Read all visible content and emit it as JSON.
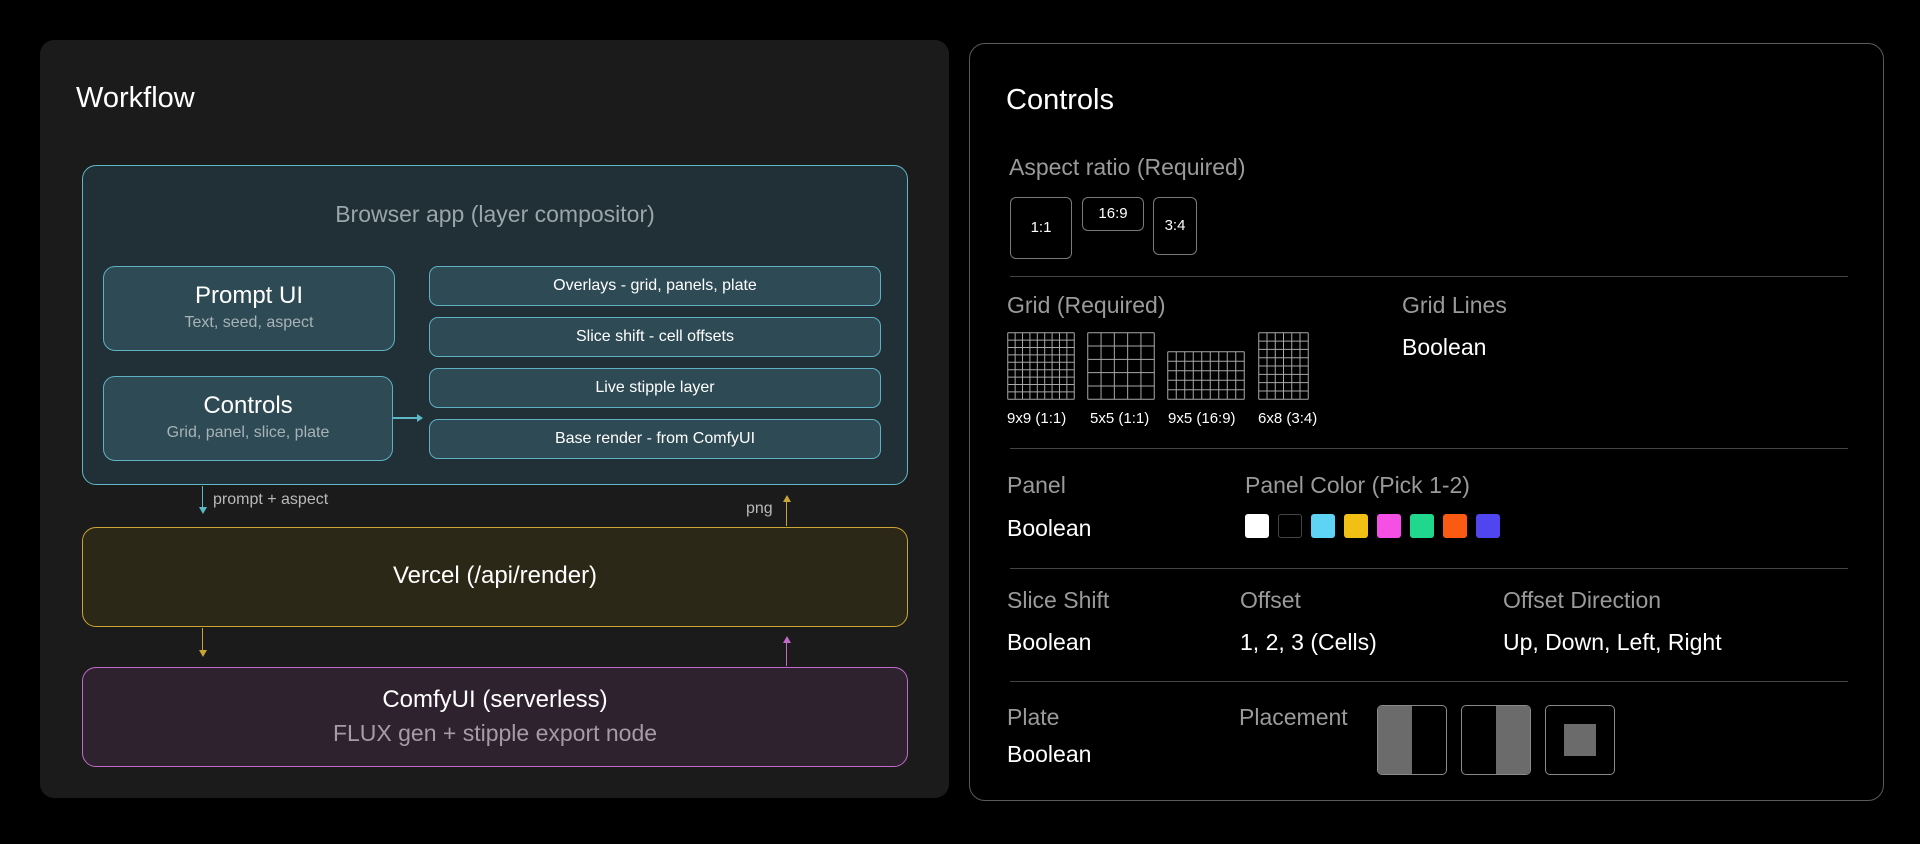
{
  "workflow": {
    "title": "Workflow",
    "browser_app": {
      "title": "Browser app (layer compositor)",
      "prompt_ui": {
        "title": "Prompt UI",
        "subtitle": "Text, seed, aspect"
      },
      "controls": {
        "title": "Controls",
        "subtitle": "Grid, panel, slice, plate"
      },
      "layers": [
        "Overlays - grid, panels, plate",
        "Slice shift - cell offsets",
        "Live stipple layer",
        "Base render - from ComfyUI"
      ]
    },
    "arrow_labels": {
      "down": "prompt + aspect",
      "up": "png"
    },
    "vercel": {
      "title": "Vercel (/api/render)"
    },
    "comfyui": {
      "title": "ComfyUI (serverless)",
      "subtitle": "FLUX gen + stipple export node"
    },
    "colors": {
      "teal": "#5fb8c7",
      "gold": "#c9a533",
      "magenta": "#c16ac9"
    }
  },
  "controls": {
    "title": "Controls",
    "aspect_ratio": {
      "label": "Aspect ratio (Required)",
      "options": [
        "1:1",
        "16:9",
        "3:4"
      ]
    },
    "grid": {
      "label": "Grid (Required)",
      "options": [
        {
          "caption": "9x9 (1:1)",
          "cols": 9,
          "rows": 9
        },
        {
          "caption": "5x5 (1:1)",
          "cols": 5,
          "rows": 5
        },
        {
          "caption": "9x5 (16:9)",
          "cols": 9,
          "rows": 5
        },
        {
          "caption": "6x8 (3:4)",
          "cols": 6,
          "rows": 8
        }
      ]
    },
    "grid_lines": {
      "label": "Grid Lines",
      "value": "Boolean"
    },
    "panel": {
      "label": "Panel",
      "value": "Boolean"
    },
    "panel_color": {
      "label": "Panel Color (Pick 1-2)",
      "swatches": [
        "#ffffff",
        "#000000",
        "#5fd3f3",
        "#f2bf14",
        "#f54fe6",
        "#1fd88d",
        "#fb5a13",
        "#5046ef"
      ]
    },
    "slice_shift": {
      "label": "Slice Shift",
      "value": "Boolean"
    },
    "offset": {
      "label": "Offset",
      "value": "1, 2, 3 (Cells)"
    },
    "offset_direction": {
      "label": "Offset Direction",
      "value": "Up, Down, Left, Right"
    },
    "plate": {
      "label": "Plate",
      "value": "Boolean"
    },
    "placement": {
      "label": "Placement",
      "options": [
        "left-half",
        "right-half",
        "center"
      ]
    }
  }
}
